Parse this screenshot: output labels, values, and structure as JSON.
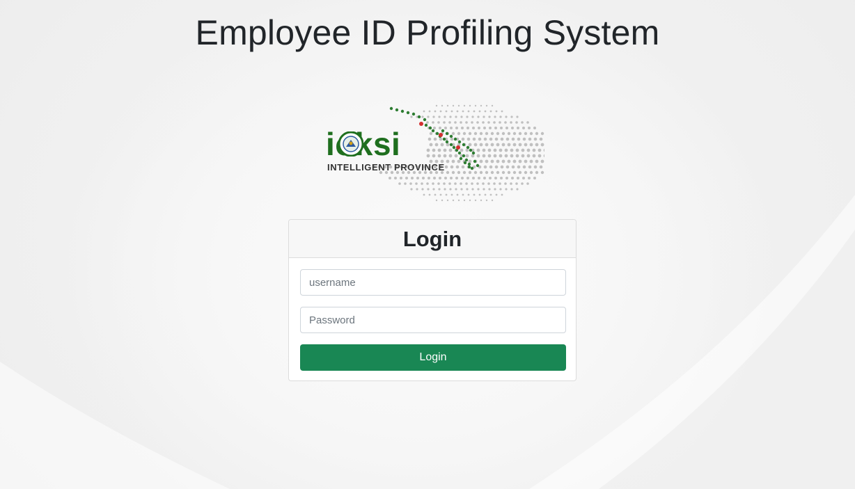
{
  "page": {
    "title": "Employee ID Profiling System"
  },
  "logo": {
    "wordmark": "ioksi",
    "tagline": "INTELLIGENT PROVINCE",
    "brand_color": "#1f6f1f",
    "dot_color": "#c0c0c0",
    "highlight_color": "#2e7d32",
    "marker_color": "#d32f2f"
  },
  "login": {
    "heading": "Login",
    "username_placeholder": "username",
    "password_placeholder": "Password",
    "submit_label": "Login",
    "button_color": "#198754"
  }
}
